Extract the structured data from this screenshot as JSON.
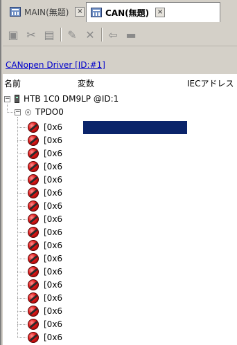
{
  "tabs": [
    {
      "label": "MAIN(無題)",
      "icon": "project-icon",
      "close": "×",
      "active": false
    },
    {
      "label": "CAN(無題)",
      "icon": "project-icon",
      "close": "×",
      "active": true
    }
  ],
  "toolbar": {
    "buttons": [
      {
        "name": "add-device-button",
        "glyph": "▣"
      },
      {
        "name": "cut-button",
        "glyph": "✂"
      },
      {
        "name": "copy-button",
        "glyph": "▤"
      },
      {
        "name": "properties-button",
        "glyph": "✎"
      },
      {
        "name": "delete-button",
        "glyph": "✕"
      },
      {
        "name": "import-button",
        "glyph": "⇦"
      },
      {
        "name": "export-button",
        "glyph": "▬"
      }
    ]
  },
  "driver_link": "CANopen Driver [ID:#1]",
  "tree": {
    "columns": {
      "name": "名前",
      "variable": "変数",
      "iec_address": "IECアドレス"
    },
    "device": {
      "expander": "−",
      "label": "HTB 1C0 DM9LP @ID:1"
    },
    "group": {
      "expander": "−",
      "label": "TPDO0"
    },
    "items": [
      {
        "label": "[0x6"
      },
      {
        "label": "[0x6"
      },
      {
        "label": "[0x6"
      },
      {
        "label": "[0x6"
      },
      {
        "label": "[0x6"
      },
      {
        "label": "[0x6"
      },
      {
        "label": "[0x6"
      },
      {
        "label": "[0x6"
      },
      {
        "label": "[0x6"
      },
      {
        "label": "[0x6"
      },
      {
        "label": "[0x6"
      },
      {
        "label": "[0x6"
      },
      {
        "label": "[0x6"
      },
      {
        "label": "[0x6"
      },
      {
        "label": "[0x6"
      },
      {
        "label": "[0x6"
      },
      {
        "label": "[0x6"
      }
    ],
    "selected_index": 0
  }
}
